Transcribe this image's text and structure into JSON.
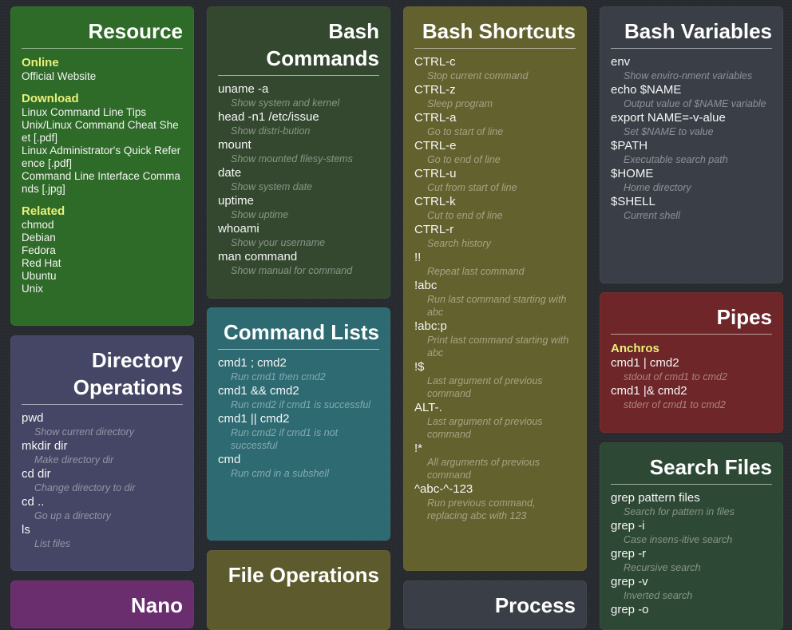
{
  "resource": {
    "title": "Resource",
    "groups": [
      {
        "heading": "Online",
        "items": [
          "Official Website"
        ]
      },
      {
        "heading": "Download",
        "items": [
          "Linux Command Line Tips",
          "Unix/Linux Command Cheat Sheet [.pdf]",
          "Linux Administrator's Quick Reference [.pdf]",
          "Command Line Interface Commands [.jpg]"
        ]
      },
      {
        "heading": "Related",
        "items": [
          "chmod",
          "Debian",
          "Fedora",
          "Red Hat",
          "Ubuntu",
          "Unix"
        ]
      }
    ]
  },
  "bash_commands": {
    "title": "Bash Commands",
    "entries": [
      {
        "cmd": "uname -a",
        "desc": "Show system and kernel"
      },
      {
        "cmd": "head -n1 /etc/issue",
        "desc": "Show distri-bution"
      },
      {
        "cmd": "mount",
        "desc": "Show mounted filesy-stems"
      },
      {
        "cmd": "date",
        "desc": "Show system date"
      },
      {
        "cmd": "uptime",
        "desc": "Show uptime"
      },
      {
        "cmd": "whoami",
        "desc": "Show your username"
      },
      {
        "cmd": "man command",
        "desc": "Show manual for command"
      }
    ]
  },
  "bash_shortcuts": {
    "title": "Bash Shortcuts",
    "entries": [
      {
        "cmd": "CTRL-c",
        "desc": "Stop current command"
      },
      {
        "cmd": "CTRL-z",
        "desc": "Sleep program"
      },
      {
        "cmd": "CTRL-a",
        "desc": "Go to start of line"
      },
      {
        "cmd": "CTRL-e",
        "desc": "Go to end of line"
      },
      {
        "cmd": "CTRL-u",
        "desc": "Cut from start of line"
      },
      {
        "cmd": "CTRL-k",
        "desc": "Cut to end of line"
      },
      {
        "cmd": "CTRL-r",
        "desc": "Search history"
      },
      {
        "cmd": "!!",
        "desc": "Repeat last command"
      },
      {
        "cmd": "!abc",
        "desc": "Run last command starting with abc"
      },
      {
        "cmd": "!abc:p",
        "desc": "Print last command starting with abc"
      },
      {
        "cmd": "!$",
        "desc": "Last argument of previous command"
      },
      {
        "cmd": "ALT-.",
        "desc": "Last argument of previous command"
      },
      {
        "cmd": "!*",
        "desc": "All arguments of previous command"
      },
      {
        "cmd": "^abc-^-123",
        "desc": "Run previous command, replacing abc with 123"
      }
    ]
  },
  "bash_variables": {
    "title": "Bash Variables",
    "entries": [
      {
        "cmd": "env",
        "desc": "Show enviro-nment variables"
      },
      {
        "cmd": "echo $NAME",
        "desc": "Output value of $NAME variable"
      },
      {
        "cmd": "export NAME=-v-alue",
        "desc": "Set $NAME to value"
      },
      {
        "cmd": "$PATH",
        "desc": "Executable search path"
      },
      {
        "cmd": "$HOME",
        "desc": "Home directory"
      },
      {
        "cmd": "$SHELL",
        "desc": "Current shell"
      }
    ]
  },
  "directory_operations": {
    "title": "Directory Operations",
    "entries": [
      {
        "cmd": "pwd",
        "desc": "Show current directory"
      },
      {
        "cmd": "mkdir dir",
        "desc": "Make directory dir"
      },
      {
        "cmd": "cd dir",
        "desc": "Change directory to dir"
      },
      {
        "cmd": "cd ..",
        "desc": "Go up a directory"
      },
      {
        "cmd": "ls",
        "desc": "List files"
      }
    ]
  },
  "command_lists": {
    "title": "Command Lists",
    "entries": [
      {
        "cmd": "cmd1 ; cmd2",
        "desc": "Run cmd1 then cmd2"
      },
      {
        "cmd": "cmd1 && cmd2",
        "desc": "Run cmd2 if cmd1 is successful"
      },
      {
        "cmd": "cmd1 || cmd2",
        "desc": "Run cmd2 if cmd1 is not successful"
      },
      {
        "cmd": "cmd",
        "desc": "Run cmd in a subshell"
      }
    ]
  },
  "pipes": {
    "title": "Pipes",
    "subhead": "Anchros",
    "entries": [
      {
        "cmd": "cmd1 | cmd2",
        "desc": "stdout of cmd1 to cmd2"
      },
      {
        "cmd": "cmd1 |& cmd2",
        "desc": "stderr of cmd1 to cmd2"
      }
    ]
  },
  "search_files": {
    "title": "Search Files",
    "entries": [
      {
        "cmd": "grep pattern files",
        "desc": "Search for pattern in files"
      },
      {
        "cmd": "grep -i",
        "desc": "Case insens-itive search"
      },
      {
        "cmd": "grep -r",
        "desc": "Recursive search"
      },
      {
        "cmd": "grep -v",
        "desc": "Inverted search"
      },
      {
        "cmd": "grep -o",
        "desc": ""
      }
    ]
  },
  "nano": {
    "title": "Nano"
  },
  "file_operations": {
    "title": "File Operations"
  },
  "process": {
    "title": "Process"
  }
}
